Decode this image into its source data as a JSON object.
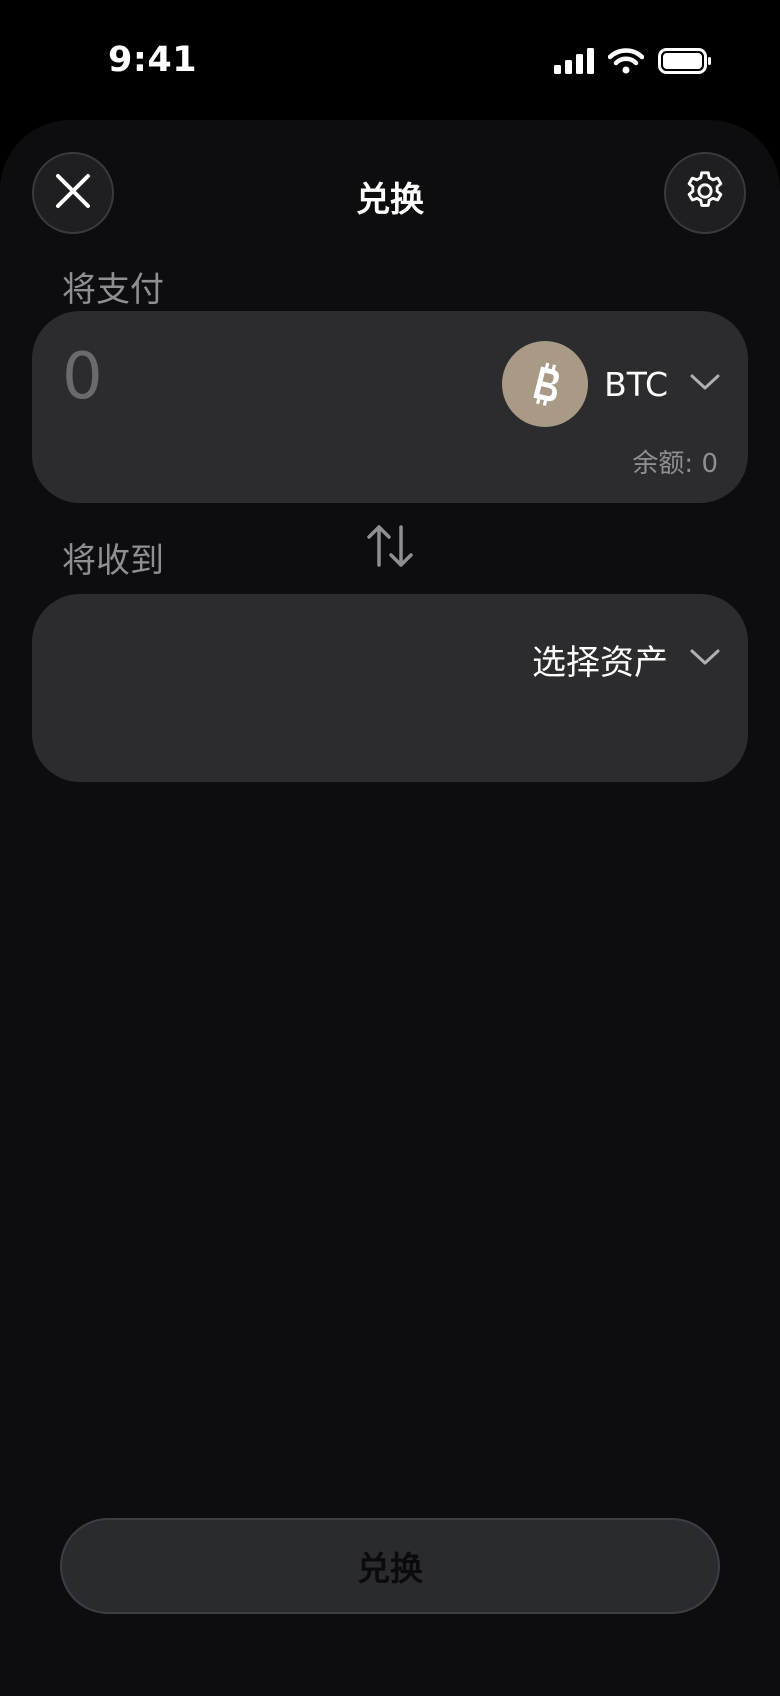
{
  "status_bar": {
    "time": "9:41",
    "icons": [
      "cellular-signal-icon",
      "wifi-icon",
      "battery-icon"
    ]
  },
  "header": {
    "title": "兑换",
    "close_icon": "close-icon",
    "settings_icon": "gear-icon"
  },
  "pay": {
    "label": "将支付",
    "amount_placeholder": "0",
    "asset_symbol": "BTC",
    "asset_icon": "bitcoin-icon",
    "balance_text": "余额: 0"
  },
  "swap_direction_icon": "swap-arrows-icon",
  "receive": {
    "label": "将收到",
    "select_label": "选择资产"
  },
  "submit": {
    "label": "兑换"
  },
  "colors": {
    "background": "#0d0d0f",
    "card": "#2c2c2e",
    "muted_text": "#8e8e93",
    "bitcoin_badge": "#a89a84",
    "primary_text": "#ffffff"
  }
}
